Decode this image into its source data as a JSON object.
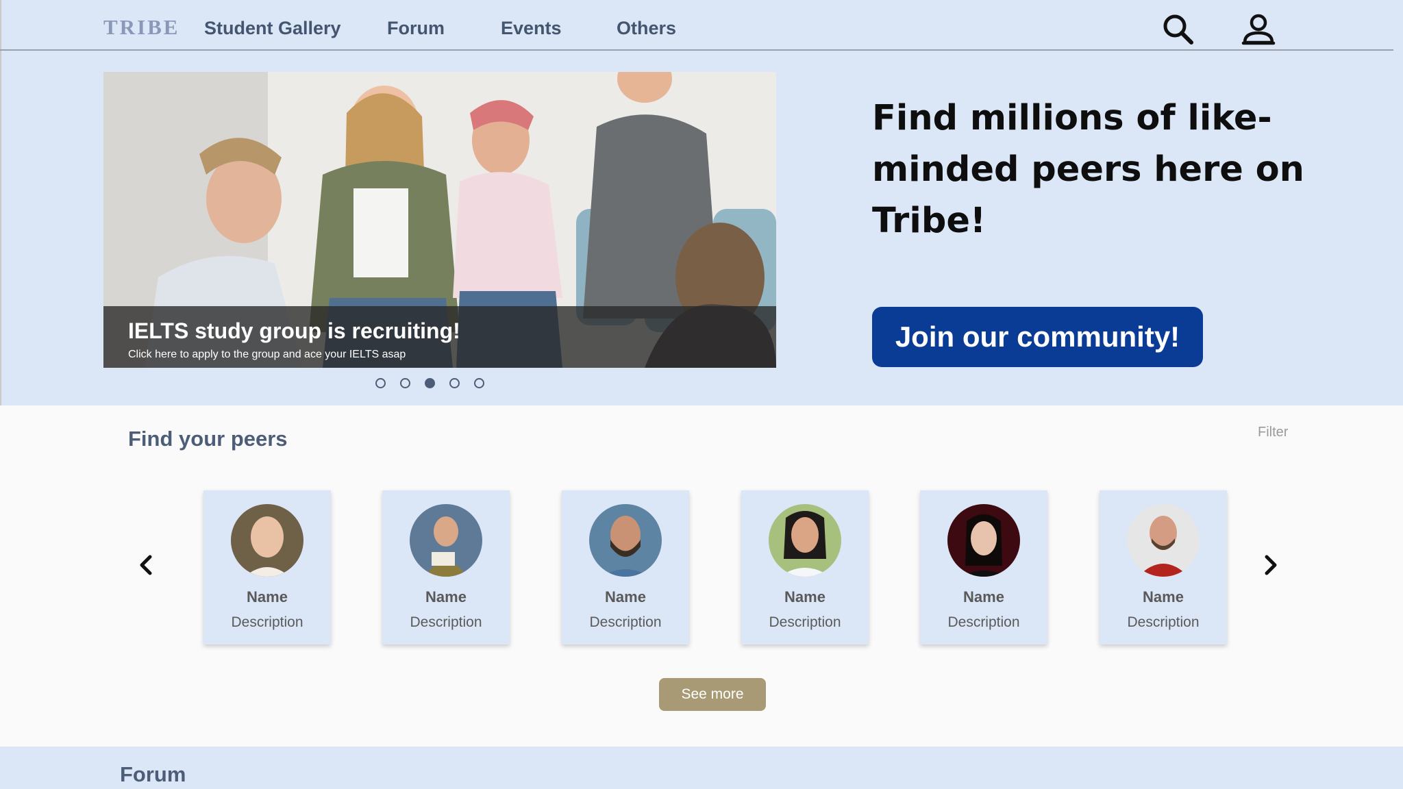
{
  "nav": {
    "logo": "TRIBE",
    "items": [
      "Student Gallery",
      "Forum",
      "Events",
      "Others"
    ]
  },
  "icons": {
    "search": "search-icon",
    "profile": "user-icon"
  },
  "carousel": {
    "title": "IELTS study group is recruiting!",
    "subtitle": "Click here to apply to the group and ace your IELTS asap",
    "total_slides": 5,
    "active_slide": 3
  },
  "hero": {
    "headline": "Find millions of like-minded peers here on Tribe!",
    "cta": "Join our community!"
  },
  "peers": {
    "title": "Find your peers",
    "filter": "Filter",
    "cards": [
      {
        "name": "Name",
        "description": "Description"
      },
      {
        "name": "Name",
        "description": "Description"
      },
      {
        "name": "Name",
        "description": "Description"
      },
      {
        "name": "Name",
        "description": "Description"
      },
      {
        "name": "Name",
        "description": "Description"
      },
      {
        "name": "Name",
        "description": "Description"
      }
    ],
    "see_more": "See more"
  },
  "forum": {
    "title": "Forum"
  },
  "colors": {
    "band": "#dbe6f6",
    "cta": "#0a3c95",
    "see_more": "#a89a74",
    "heading": "#4d5d78"
  }
}
